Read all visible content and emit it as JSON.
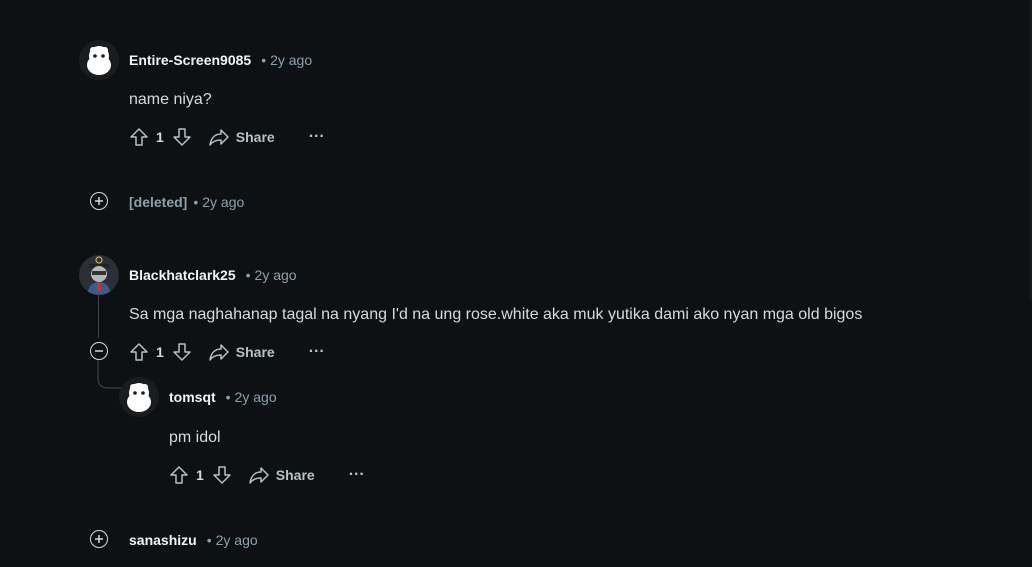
{
  "comments": [
    {
      "username": "Entire-Screen9085",
      "time": "2y ago",
      "separator": "•",
      "body": "name niya?",
      "score": "1",
      "share_label": "Share",
      "more_label": "···"
    },
    {
      "username": "[deleted]",
      "time": "2y ago",
      "separator": "•"
    },
    {
      "username": "Blackhatclark25",
      "time": "2y ago",
      "separator": "•",
      "body": "Sa mga naghahanap tagal na nyang I'd na ung rose.white aka muk yutika dami ako nyan mga old bigos",
      "score": "1",
      "share_label": "Share",
      "more_label": "···"
    },
    {
      "username": "tomsqt",
      "time": "2y ago",
      "separator": "•",
      "body": "pm idol",
      "score": "1",
      "share_label": "Share",
      "more_label": "···"
    },
    {
      "username": "sanashizu",
      "time": "2y ago",
      "separator": "•"
    }
  ],
  "icons": [
    "reddit-snoo-avatar-icon",
    "upvote-icon",
    "downvote-icon",
    "share-icon",
    "more-icon",
    "expand-plus-icon",
    "collapse-minus-icon"
  ],
  "colors": {
    "background": "#0e1113",
    "text": "#d7dadc",
    "muted": "#8ba2ad",
    "thread": "#3a4248"
  }
}
